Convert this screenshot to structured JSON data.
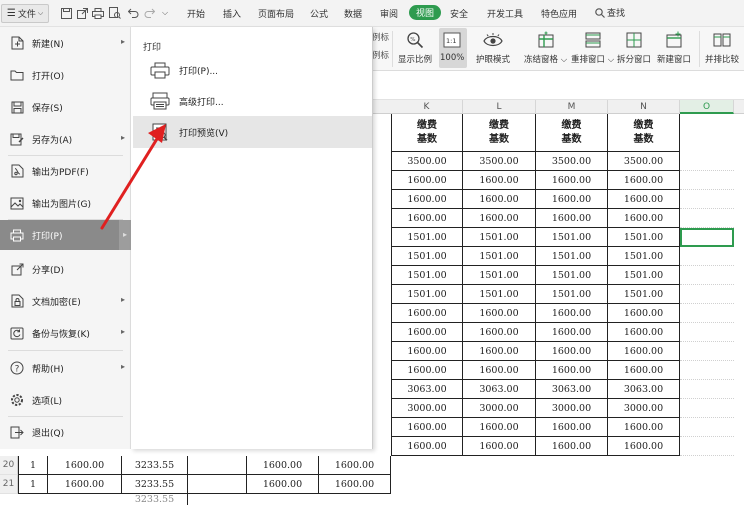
{
  "menubar": {
    "file_label": "文件",
    "tabs": [
      "开始",
      "插入",
      "页面布局",
      "公式",
      "数据",
      "审阅",
      "视图",
      "安全",
      "开发工具",
      "特色应用"
    ],
    "active_tab": "视图",
    "search_label": "查找"
  },
  "ribbon": {
    "partial_1": "例标",
    "partial_2": "例标",
    "buttons": [
      {
        "label": "显示比例",
        "icon": "zoom-icon"
      },
      {
        "label": "100%",
        "icon": "zoom-100-icon"
      },
      {
        "label": "护眼模式",
        "icon": "eye-icon"
      },
      {
        "label": "冻结窗格",
        "icon": "freeze-panes-icon"
      },
      {
        "label": "重排窗口",
        "icon": "arrange-windows-icon"
      },
      {
        "label": "拆分窗口",
        "icon": "split-window-icon"
      },
      {
        "label": "新建窗口",
        "icon": "new-window-icon"
      },
      {
        "label": "并排比较",
        "icon": "side-by-side-icon"
      }
    ]
  },
  "file_menu": {
    "items": [
      {
        "label": "新建(N)",
        "icon": "new-doc-icon",
        "has_submenu": true
      },
      {
        "label": "打开(O)",
        "icon": "folder-icon",
        "has_submenu": false
      },
      {
        "label": "保存(S)",
        "icon": "save-icon",
        "has_submenu": false
      },
      {
        "label": "另存为(A)",
        "icon": "save-as-icon",
        "has_submenu": true
      },
      {
        "label": "输出为PDF(F)",
        "icon": "pdf-icon",
        "has_submenu": false
      },
      {
        "label": "输出为图片(G)",
        "icon": "image-icon",
        "has_submenu": false
      },
      {
        "label": "打印(P)",
        "icon": "printer-icon",
        "has_submenu": true,
        "active": true
      },
      {
        "label": "分享(D)",
        "icon": "share-icon",
        "has_submenu": false
      },
      {
        "label": "文档加密(E)",
        "icon": "encrypt-icon",
        "has_submenu": true
      },
      {
        "label": "备份与恢复(K)",
        "icon": "backup-icon",
        "has_submenu": true
      },
      {
        "label": "帮助(H)",
        "icon": "help-icon",
        "has_submenu": true
      },
      {
        "label": "选项(L)",
        "icon": "gear-icon",
        "has_submenu": false
      },
      {
        "label": "退出(Q)",
        "icon": "exit-icon",
        "has_submenu": false
      }
    ]
  },
  "print_submenu": {
    "title": "打印",
    "items": [
      {
        "label": "打印(P)...",
        "icon": "printer-icon"
      },
      {
        "label": "高级打印...",
        "icon": "advanced-print-icon"
      },
      {
        "label": "打印预览(V)",
        "icon": "print-preview-icon",
        "hover": true
      }
    ]
  },
  "sheet": {
    "columns": [
      "K",
      "L",
      "M",
      "N",
      "O"
    ],
    "selected_column": "O",
    "header_line1": "缴费",
    "header_line2": "基数",
    "rows": [
      "3500.00",
      "1600.00",
      "1600.00",
      "1600.00",
      "1501.00",
      "1501.00",
      "1501.00",
      "1501.00",
      "1600.00",
      "1600.00",
      "1600.00",
      "1600.00",
      "3063.00",
      "3000.00",
      "1600.00",
      "1600.00",
      "1600.00",
      "1600.00",
      "1600.00"
    ],
    "bottom_rows": [
      {
        "num": "20",
        "a": "1",
        "b": "1600.00",
        "c": "3233.55",
        "d": "1600.00",
        "e": "1600.00"
      },
      {
        "num": "21",
        "a": "1",
        "b": "1600.00",
        "c": "3233.55",
        "d": "1600.00",
        "e": "1600.00"
      }
    ],
    "partial_cell": "3233.55"
  },
  "colors": {
    "accent_green": "#2e9b4f",
    "arrow_red": "#e02020",
    "menu_active": "#8a8a8a"
  }
}
